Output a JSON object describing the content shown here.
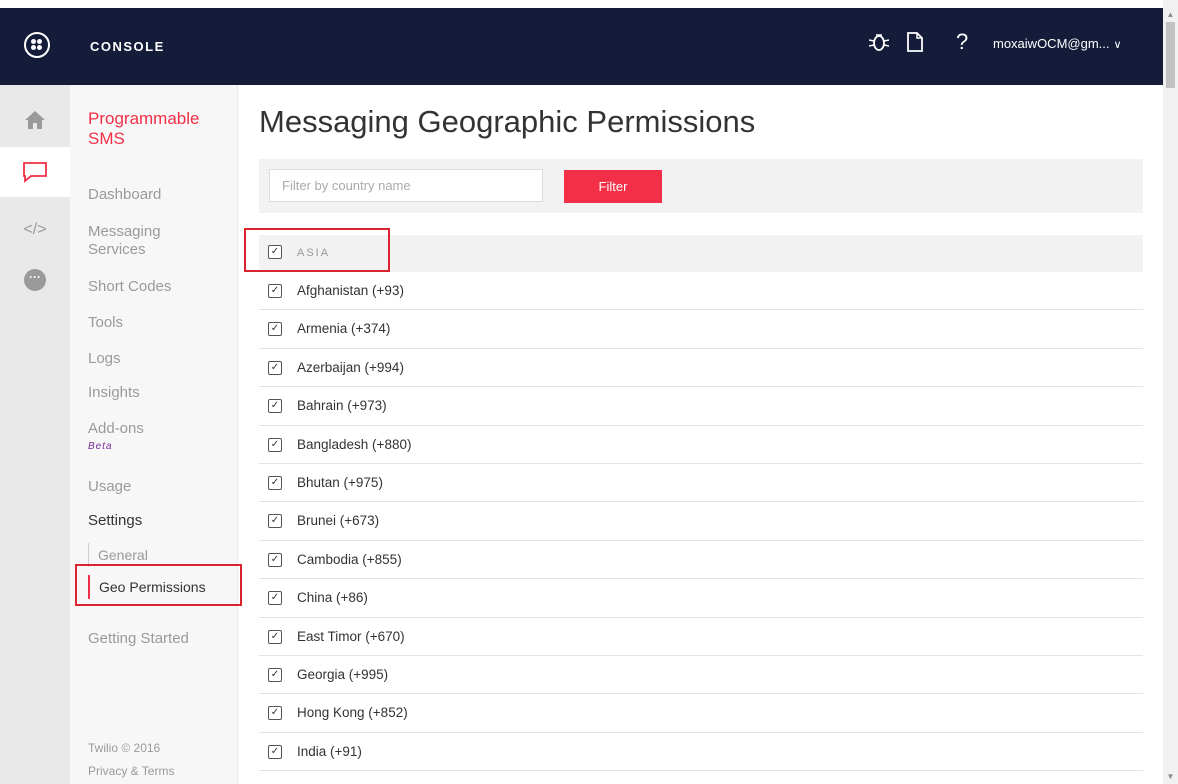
{
  "header": {
    "title": "CONSOLE",
    "icons": [
      "logo-icon",
      "debugger-icon",
      "docs-icon",
      "help-icon"
    ],
    "account": "moxaiwOCM@gm...",
    "help_glyph": "?"
  },
  "rail": {
    "items": [
      "home-icon",
      "messaging-icon",
      "code-icon",
      "more-icon"
    ]
  },
  "nav": {
    "title": "Programmable SMS",
    "items": [
      {
        "label": "Dashboard"
      },
      {
        "label": "Messaging Services"
      },
      {
        "label": "Short Codes"
      },
      {
        "label": "Tools"
      },
      {
        "label": "Logs"
      },
      {
        "label": "Insights"
      },
      {
        "label": "Add-ons"
      },
      {
        "label": "Usage"
      },
      {
        "label": "Settings"
      },
      {
        "label": "Getting Started"
      }
    ],
    "beta": "Beta",
    "sub_items": [
      {
        "label": "General"
      },
      {
        "label": "Geo Permissions"
      }
    ],
    "footer": {
      "copyright": "Twilio © 2016",
      "privacy": "Privacy & Terms"
    }
  },
  "main": {
    "title": "Messaging Geographic Permissions",
    "filter_placeholder": "Filter by country name",
    "filter_button": "Filter",
    "region": "ASIA",
    "countries": [
      "Afghanistan (+93)",
      "Armenia (+374)",
      "Azerbaijan (+994)",
      "Bahrain (+973)",
      "Bangladesh (+880)",
      "Bhutan (+975)",
      "Brunei (+673)",
      "Cambodia (+855)",
      "China (+86)",
      "East Timor (+670)",
      "Georgia (+995)",
      "Hong Kong (+852)",
      "India (+91)"
    ]
  },
  "colors": {
    "topbar": "#141c3a",
    "accent": "#f22f46",
    "highlight_box": "#d9232d"
  }
}
